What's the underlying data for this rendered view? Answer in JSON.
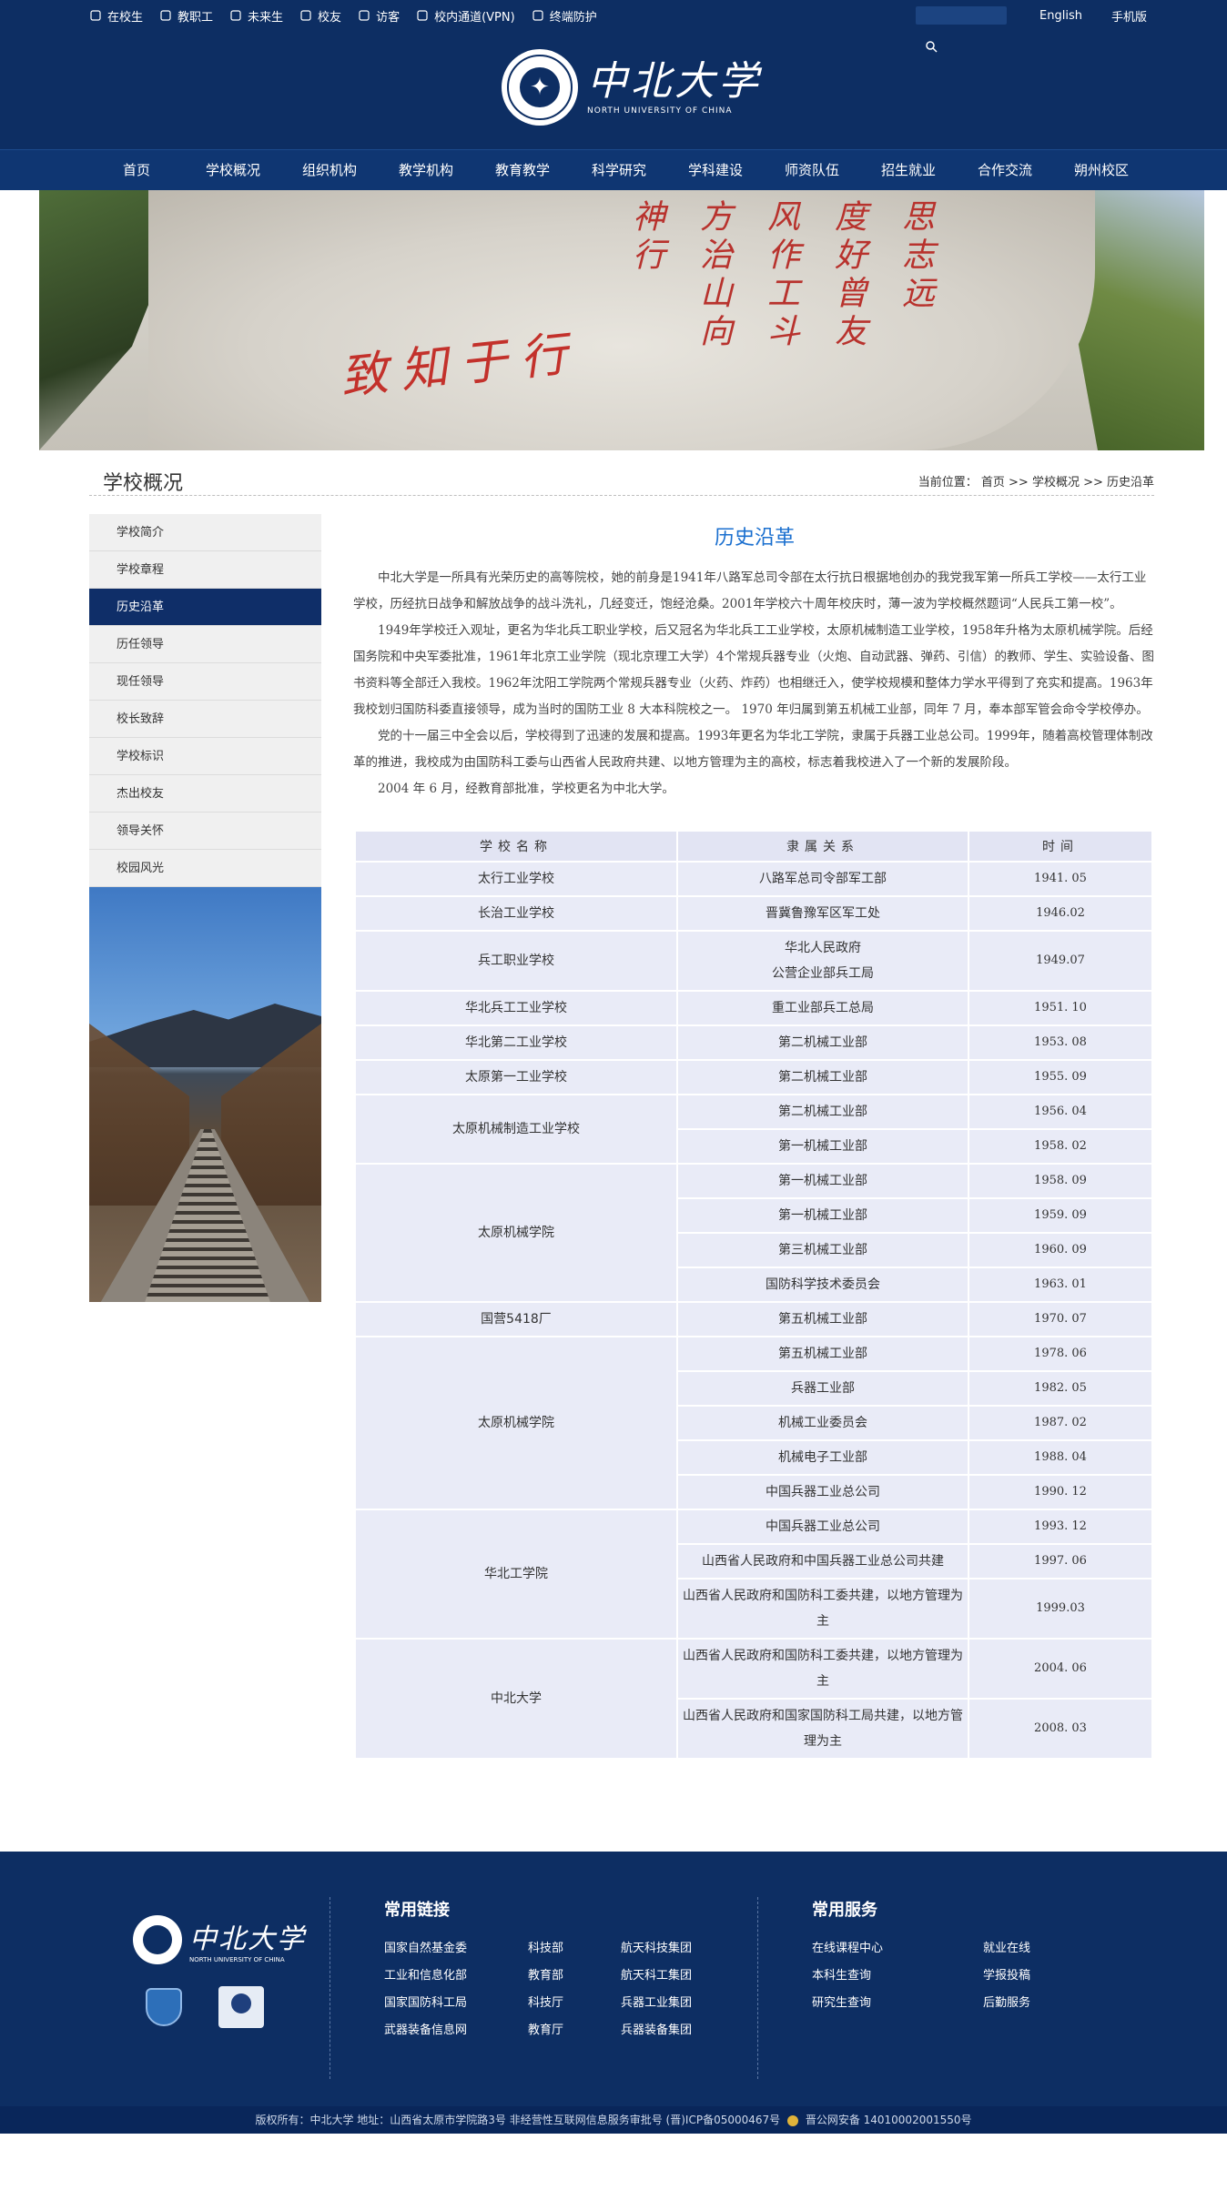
{
  "topbar": {
    "links": [
      "在校生",
      "教职工",
      "未来生",
      "校友",
      "访客",
      "校内通道(VPN)",
      "终端防护"
    ],
    "right_links": [
      "English",
      "手机版"
    ]
  },
  "logo": {
    "cn": "中北大学",
    "en": "NORTH UNIVERSITY OF CHINA"
  },
  "nav": [
    "首页",
    "学校概况",
    "组织机构",
    "教学机构",
    "教育教学",
    "科学研究",
    "学科建设",
    "师资队伍",
    "招生就业",
    "合作交流",
    "朔州校区"
  ],
  "banner": {
    "carve": "致知于行",
    "poem_cols": [
      "神行",
      "方治山向",
      "风作工斗",
      "度好曾友",
      "思志远"
    ]
  },
  "section": {
    "title": "学校概况",
    "breadcrumb": "当前位置： 首页 >> 学校概况 >> 历史沿革"
  },
  "sidebar": [
    "学校简介",
    "学校章程",
    "历史沿革",
    "历任领导",
    "现任领导",
    "校长致辞",
    "学校标识",
    "杰出校友",
    "领导关怀",
    "校园风光"
  ],
  "content": {
    "title": "历史沿革",
    "paragraphs": [
      "中北大学是一所具有光荣历史的高等院校，她的前身是1941年八路军总司令部在太行抗日根据地创办的我党我军第一所兵工学校——太行工业学校，历经抗日战争和解放战争的战斗洗礼，几经变迁，饱经沧桑。2001年学校六十周年校庆时，薄一波为学校概然题词“人民兵工第一校”。",
      "1949年学校迁入观址，更名为华北兵工职业学校，后又冠名为华北兵工工业学校，太原机械制造工业学校，1958年升格为太原机械学院。后经国务院和中央军委批准，1961年北京工业学院（现北京理工大学）4个常规兵器专业（火炮、自动武器、弹药、引信）的教师、学生、实验设备、图书资料等全部迁入我校。1962年沈阳工学院两个常规兵器专业（火药、炸药）也相继迁入，使学校规模和整体力学水平得到了充实和提高。1963年我校划归国防科委直接领导，成为当时的国防工业 8 大本科院校之一。 1970 年归属到第五机械工业部，同年 7 月，奉本部军管会命令学校停办。",
      "党的十一届三中全会以后，学校得到了迅速的发展和提高。1993年更名为华北工学院，隶属于兵器工业总公司。1999年，随着高校管理体制改革的推进，我校成为由国防科工委与山西省人民政府共建、以地方管理为主的高校，标志着我校进入了一个新的发展阶段。",
      "2004 年 6 月，经教育部批准，学校更名为中北大学。"
    ]
  },
  "table": {
    "headers": [
      "学校名称",
      "隶属关系",
      "时间"
    ],
    "groups": [
      {
        "name": "太行工业学校",
        "rows": [
          {
            "aff": "八路军总司令部军工部",
            "time": "1941. 05"
          }
        ]
      },
      {
        "name": "长治工业学校",
        "rows": [
          {
            "aff": "晋冀鲁豫军区军工处",
            "time": "1946.02"
          }
        ]
      },
      {
        "name": "兵工职业学校",
        "rows": [
          {
            "aff": "华北人民政府\n公营企业部兵工局",
            "time": "1949.07"
          }
        ]
      },
      {
        "name": "华北兵工工业学校",
        "rows": [
          {
            "aff": "重工业部兵工总局",
            "time": "1951. 10"
          }
        ]
      },
      {
        "name": "华北第二工业学校",
        "rows": [
          {
            "aff": "第二机械工业部",
            "time": "1953. 08"
          }
        ]
      },
      {
        "name": "太原第一工业学校",
        "rows": [
          {
            "aff": "第二机械工业部",
            "time": "1955. 09"
          }
        ]
      },
      {
        "name": "太原机械制造工业学校",
        "rows": [
          {
            "aff": "第二机械工业部",
            "time": "1956. 04"
          },
          {
            "aff": "第一机械工业部",
            "time": "1958. 02"
          }
        ]
      },
      {
        "name": "太原机械学院",
        "rows": [
          {
            "aff": "第一机械工业部",
            "time": "1958. 09"
          },
          {
            "aff": "第一机械工业部",
            "time": "1959. 09"
          },
          {
            "aff": "第三机械工业部",
            "time": "1960. 09"
          },
          {
            "aff": "国防科学技术委员会",
            "time": "1963. 01"
          }
        ]
      },
      {
        "name": "国营5418厂",
        "rows": [
          {
            "aff": "第五机械工业部",
            "time": "1970. 07"
          }
        ]
      },
      {
        "name": "太原机械学院",
        "rows": [
          {
            "aff": "第五机械工业部",
            "time": "1978. 06"
          },
          {
            "aff": "兵器工业部",
            "time": "1982. 05"
          },
          {
            "aff": "机械工业委员会",
            "time": "1987. 02"
          },
          {
            "aff": "机械电子工业部",
            "time": "1988. 04"
          },
          {
            "aff": "中国兵器工业总公司",
            "time": "1990. 12"
          }
        ]
      },
      {
        "name": "华北工学院",
        "rows": [
          {
            "aff": "中国兵器工业总公司",
            "time": "1993. 12"
          },
          {
            "aff": "山西省人民政府和中国兵器工业总公司共建",
            "time": "1997. 06"
          },
          {
            "aff": "山西省人民政府和国防科工委共建，以地方管理为主",
            "time": "1999.03"
          }
        ]
      },
      {
        "name": "中北大学",
        "rows": [
          {
            "aff": "山西省人民政府和国防科工委共建，以地方管理为主",
            "time": "2004. 06"
          },
          {
            "aff": "山西省人民政府和国家国防科工局共建，以地方管理为主",
            "time": "2008. 03"
          }
        ]
      }
    ]
  },
  "footer": {
    "links_title": "常用链接",
    "links": [
      "国家自然基金委",
      "科技部",
      "航天科技集团",
      "工业和信息化部",
      "教育部",
      "航天科工集团",
      "国家国防科工局",
      "科技厅",
      "兵器工业集团",
      "武器装备信息网",
      "教育厅",
      "兵器装备集团"
    ],
    "services_title": "常用服务",
    "services": [
      "在线课程中心",
      "就业在线",
      "本科生查询",
      "学报投稿",
      "研究生查询",
      "后勤服务"
    ],
    "copyright": "版权所有：中北大学    地址：山西省太原市学院路3号    非经营性互联网信息服务审批号 (晋)ICP备05000467号",
    "police": "晋公网安备 14010002001550号"
  },
  "colors": {
    "brand": "#0d2e63",
    "accent": "#1a6fcf",
    "table_cell": "#e9ebf7"
  }
}
